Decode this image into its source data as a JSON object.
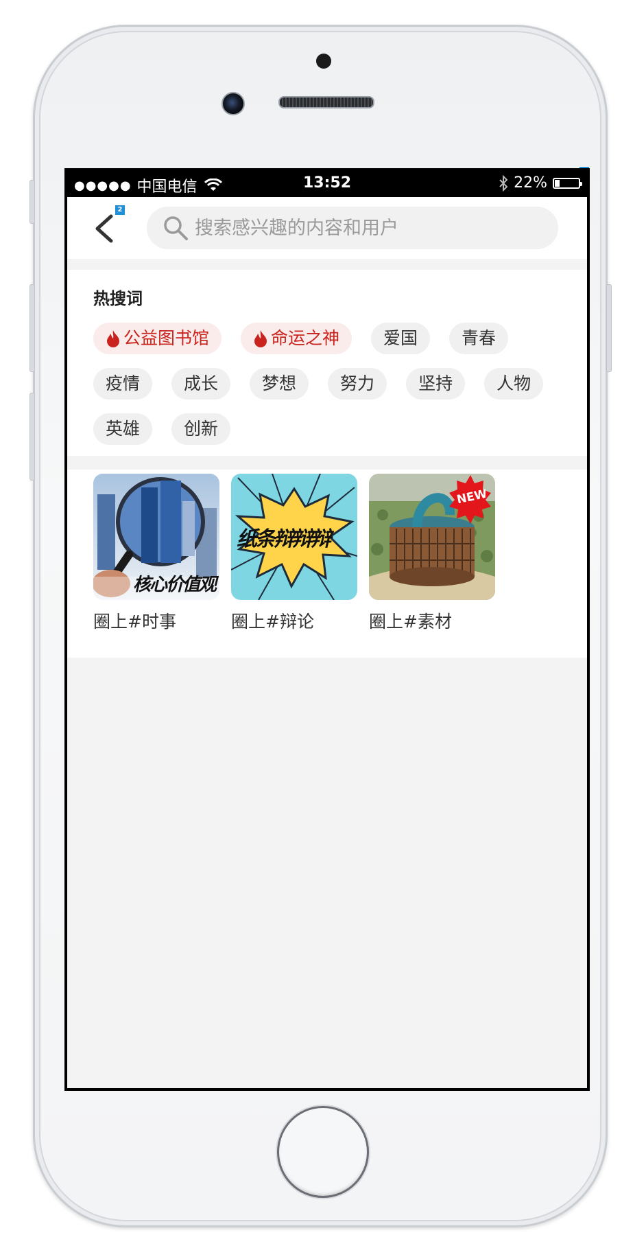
{
  "status_bar": {
    "signal_dots": "●●●●●",
    "carrier": "中国电信",
    "time": "13:52",
    "battery": "22%",
    "battery_level": 0.22
  },
  "badges": {
    "corner": "1",
    "back": "2"
  },
  "search": {
    "placeholder": "搜索感兴趣的内容和用户",
    "value": ""
  },
  "hot_search": {
    "title": "热搜词",
    "tags": [
      {
        "label": "公益图书馆",
        "hot": true
      },
      {
        "label": "命运之神",
        "hot": true
      },
      {
        "label": "爱国",
        "hot": false
      },
      {
        "label": "青春",
        "hot": false
      },
      {
        "label": "疫情",
        "hot": false
      },
      {
        "label": "成长",
        "hot": false
      },
      {
        "label": "梦想",
        "hot": false
      },
      {
        "label": "努力",
        "hot": false
      },
      {
        "label": "坚持",
        "hot": false
      },
      {
        "label": "人物",
        "hot": false
      },
      {
        "label": "英雄",
        "hot": false
      },
      {
        "label": "创新",
        "hot": false
      }
    ]
  },
  "circles": [
    {
      "label": "圈上#时事",
      "image_text": "核心价值观"
    },
    {
      "label": "圈上#辩论",
      "image_text": "纸条辩辩辩"
    },
    {
      "label": "圈上#素材",
      "badge": "NEW"
    }
  ],
  "colors": {
    "hot_text": "#c8231d",
    "hot_bg": "#fbecec",
    "tag_bg": "#f0f0f0",
    "badge": "#1e8fd8",
    "new_badge": "#e3161b"
  }
}
